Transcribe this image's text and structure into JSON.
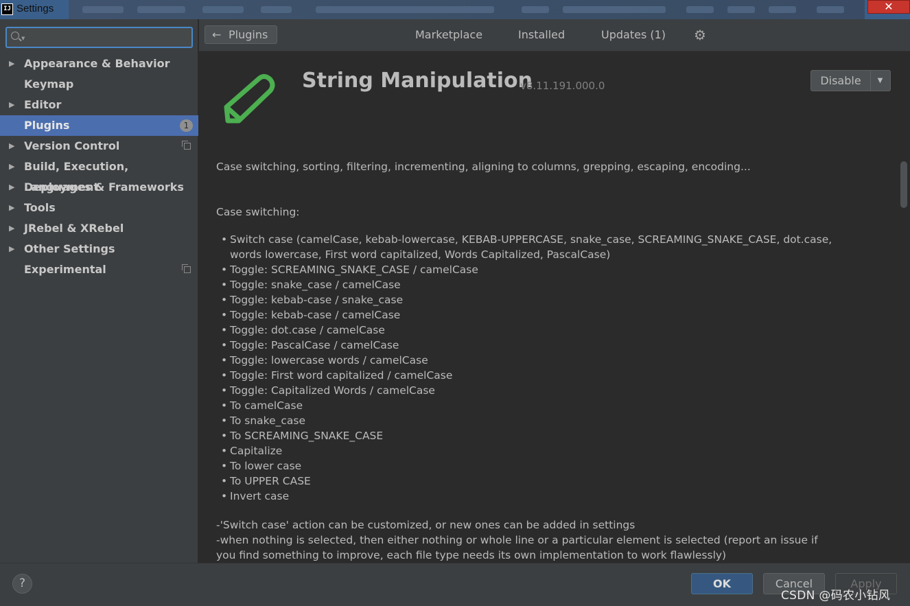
{
  "window": {
    "title": "Settings",
    "close_label": "✕"
  },
  "sidebar": {
    "search": {
      "value": "",
      "placeholder": ""
    },
    "items": [
      {
        "label": "Appearance & Behavior",
        "expandable": true
      },
      {
        "label": "Keymap",
        "expandable": false
      },
      {
        "label": "Editor",
        "expandable": true
      },
      {
        "label": "Plugins",
        "expandable": false,
        "selected": true,
        "badge": "1"
      },
      {
        "label": "Version Control",
        "expandable": true,
        "project_icon": true
      },
      {
        "label": "Build, Execution, Deployment",
        "expandable": true
      },
      {
        "label": "Languages & Frameworks",
        "expandable": true
      },
      {
        "label": "Tools",
        "expandable": true
      },
      {
        "label": "JRebel & XRebel",
        "expandable": true
      },
      {
        "label": "Other Settings",
        "expandable": true
      },
      {
        "label": "Experimental",
        "expandable": false,
        "project_icon": true
      }
    ]
  },
  "toolbar": {
    "back_label": "Plugins",
    "tabs": [
      "Marketplace",
      "Installed",
      "Updates (1)"
    ],
    "gear_icon": "gear-icon"
  },
  "plugin": {
    "name": "String Manipulation",
    "version": "v8.11.191.000.0",
    "action_label": "Disable",
    "icon_color": "#4caf50",
    "summary": "Case switching, sorting, filtering, incrementing, aligning to columns, grepping, escaping, encoding...",
    "section_title": "Case switching:",
    "features": [
      "Switch case (camelCase, kebab-lowercase, KEBAB-UPPERCASE, snake_case, SCREAMING_SNAKE_CASE, dot.case, words lowercase, First word capitalized, Words Capitalized, PascalCase)",
      "Toggle: SCREAMING_SNAKE_CASE / camelCase",
      "Toggle: snake_case / camelCase",
      "Toggle: kebab-case / snake_case",
      "Toggle: kebab-case / camelCase",
      "Toggle: dot.case / camelCase",
      "Toggle: PascalCase / camelCase",
      "Toggle: lowercase words / camelCase",
      "Toggle: First word capitalized / camelCase",
      "Toggle: Capitalized Words / camelCase",
      "To camelCase",
      "To snake_case",
      "To SCREAMING_SNAKE_CASE",
      "Capitalize",
      "To lower case",
      "To UPPER CASE",
      "Invert case"
    ],
    "notes": [
      "-'Switch case' action can be customized, or new ones can be added in settings",
      "-when nothing is selected, then either nothing or whole line or a particular element is selected (report an issue if you find something to improve, each file type needs its own implementation to work flawlessly)"
    ]
  },
  "footer": {
    "help_label": "?",
    "ok_label": "OK",
    "cancel_label": "Cancel",
    "apply_label": "Apply",
    "watermark": "CSDN @码农小钻风"
  },
  "colors": {
    "accent": "#4b6eaf",
    "ok_button": "#365880",
    "title_bar": "#3a5f8a",
    "close_button": "#c7352c"
  }
}
